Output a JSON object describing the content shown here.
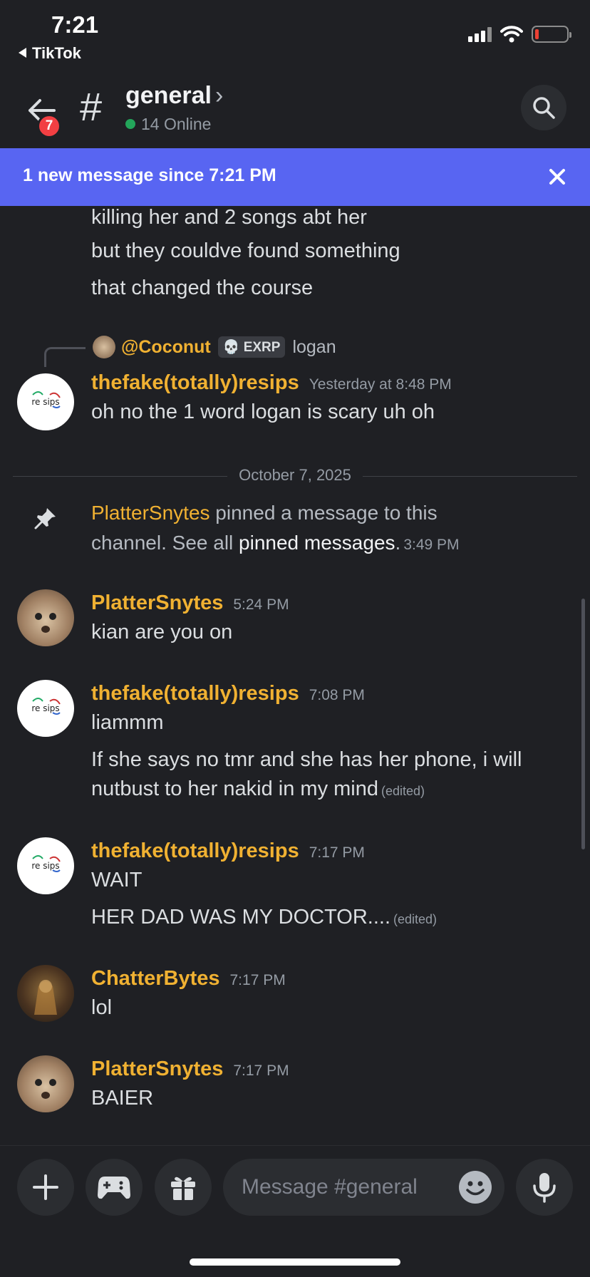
{
  "status_bar": {
    "time": "7:21",
    "back_app": "TikTok"
  },
  "header": {
    "back_badge_count": "7",
    "channel_hash": "#",
    "channel_name": "general",
    "online_text": "14 Online"
  },
  "banner": {
    "text": "1 new message since 7:21 PM"
  },
  "messages": {
    "continued": [
      "killing her and 2 songs abt her",
      "but they couldve found something",
      "that changed the course"
    ],
    "reply": {
      "reply_to_name": "@Coconut",
      "reply_tag": "EXRP",
      "reply_text": "logan",
      "author": "thefake(totally)resips",
      "timestamp": "Yesterday at 8:48 PM",
      "text": "oh no the 1 word logan is scary uh oh"
    },
    "divider_date": "October 7, 2025",
    "pinned": {
      "user": "PlatterSnytes",
      "text_before": " pinned a message to this",
      "text_line2": "channel. See all ",
      "link": "pinned messages",
      "text_after": ".",
      "timestamp": "3:49 PM"
    },
    "m1": {
      "author": "PlatterSnytes",
      "timestamp": "5:24 PM",
      "text": "kian are you on"
    },
    "m2": {
      "author": "thefake(totally)resips",
      "timestamp": "7:08 PM",
      "line1": "liammm",
      "line2": "If she says no tmr and she has her phone, i will",
      "line3": "nutbust to her nakid in my mind",
      "edited": "(edited)"
    },
    "m3": {
      "author": "thefake(totally)resips",
      "timestamp": "7:17 PM",
      "line1": "WAIT",
      "line2": "HER DAD WAS MY DOCTOR....",
      "edited": "(edited)"
    },
    "m4": {
      "author": "ChatterBytes",
      "timestamp": "7:17 PM",
      "text": "lol"
    },
    "m5": {
      "author": "PlatterSnytes",
      "timestamp": "7:17 PM",
      "text": "BAIER"
    }
  },
  "composer": {
    "placeholder": "Message #general"
  },
  "colors": {
    "background": "#1f2024",
    "accent": "#5865f2",
    "username": "#f0b132",
    "online": "#23a55a",
    "badge": "#f23f43"
  }
}
